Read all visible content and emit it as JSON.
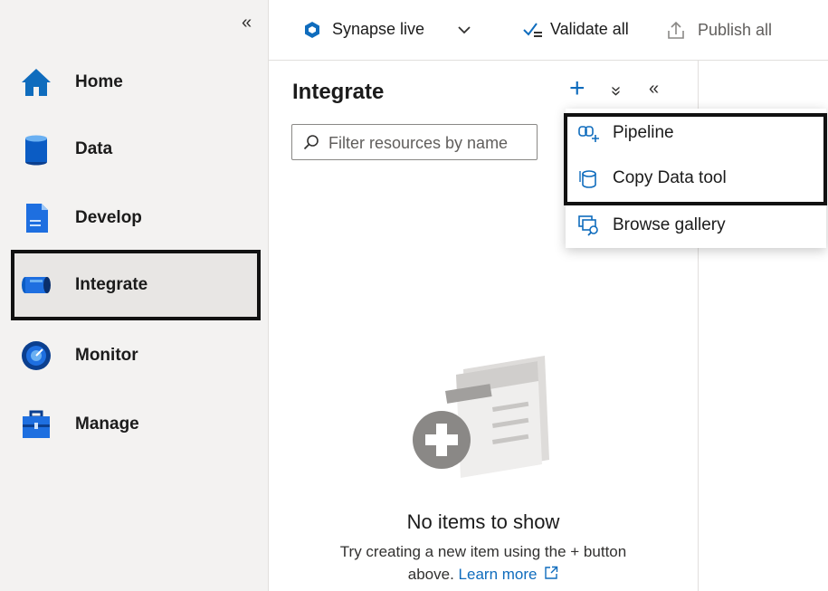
{
  "sidebar": {
    "collapse_glyph": "«",
    "items": [
      {
        "label": "Home",
        "icon": "home-icon"
      },
      {
        "label": "Data",
        "icon": "database-icon"
      },
      {
        "label": "Develop",
        "icon": "document-icon"
      },
      {
        "label": "Integrate",
        "icon": "pipeline-icon",
        "selected": true
      },
      {
        "label": "Monitor",
        "icon": "gauge-icon"
      },
      {
        "label": "Manage",
        "icon": "toolbox-icon"
      }
    ]
  },
  "topbar": {
    "workspace_label": "Synapse live",
    "validate_label": "Validate all",
    "publish_label": "Publish all"
  },
  "panel": {
    "title": "Integrate",
    "filter_placeholder": "Filter resources by name",
    "add_glyph": "+",
    "expand_glyph": "»",
    "collapse_glyph": "«"
  },
  "dropdown": {
    "items": [
      {
        "label": "Pipeline",
        "icon": "pipeline-icon"
      },
      {
        "label": "Copy Data tool",
        "icon": "copy-data-icon"
      },
      {
        "label": "Browse gallery",
        "icon": "gallery-icon"
      }
    ]
  },
  "empty_state": {
    "title": "No items to show",
    "desc_part1": "Try creating a new item using the + button",
    "desc_part2": "above.",
    "link": "Learn more"
  },
  "colors": {
    "accent": "#0f6cbd",
    "sidebar_bg": "#f3f2f1",
    "selected_bg": "#e8e6e4"
  }
}
